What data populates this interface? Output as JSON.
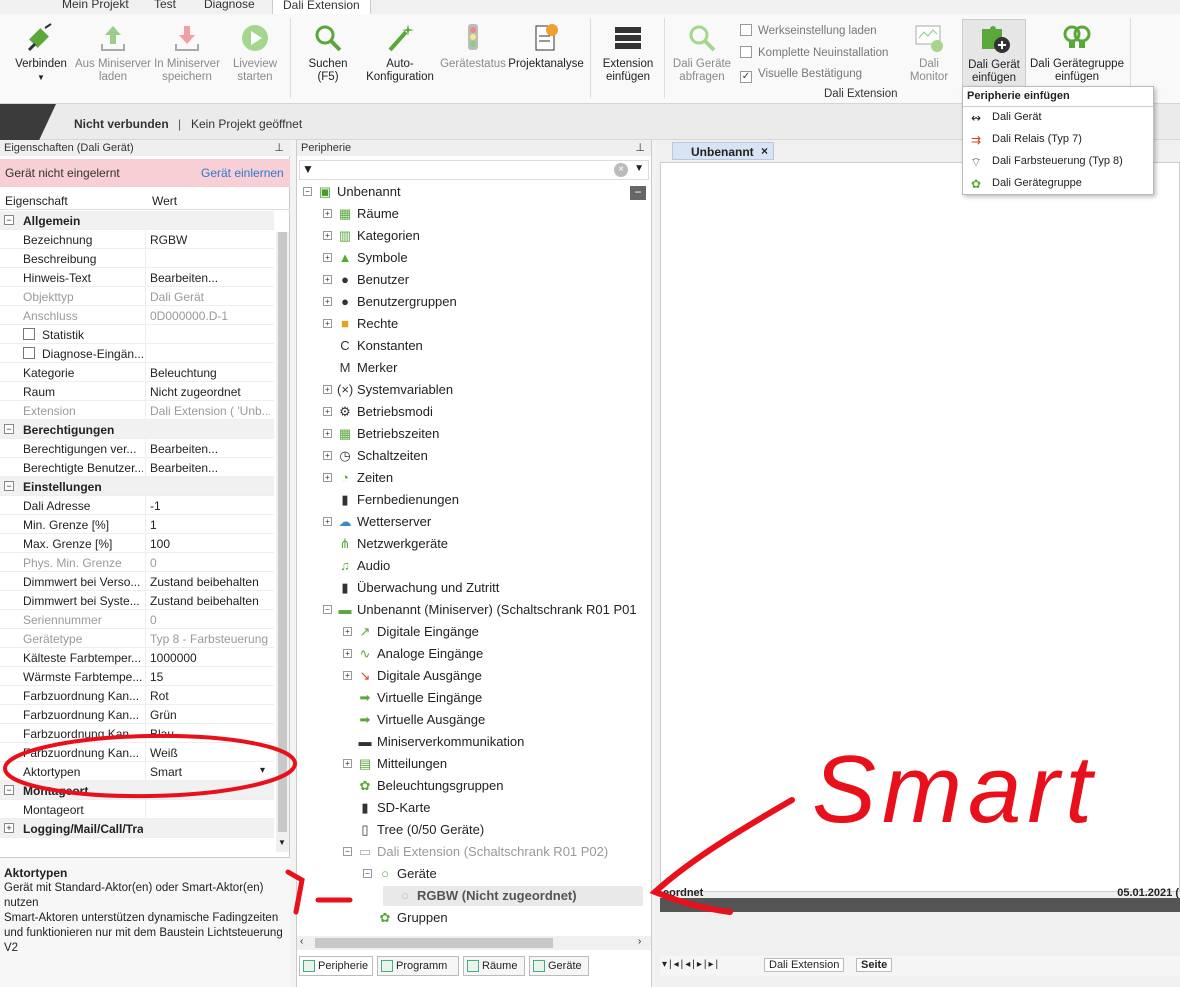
{
  "ribbon": {
    "tabs": [
      "Mein Projekt",
      "Test",
      "Diagnose",
      "Dali Extension"
    ],
    "buttons": {
      "verbinden": "Verbinden",
      "aus_miniserver": "Aus Miniserver\nladen",
      "in_miniserver": "In Miniserver\nspeichern",
      "liveview": "Liveview\nstarten",
      "suchen": "Suchen\n(F5)",
      "autokonfig": "Auto-\nKonfiguration",
      "geraetestatus": "Gerätestatus",
      "projektanalyse": "Projektanalyse",
      "extension_einfuegen": "Extension\neinfügen",
      "dali_abfragen": "Dali Geräte\nabfragen",
      "dali_monitor": "Dali\nMonitor",
      "dali_geraet_einfuegen": "Dali Gerät\neinfügen",
      "dali_gruppe_einfuegen": "Dali Gerätegruppe\neinfügen"
    },
    "checkboxes": [
      "Werkseinstellung laden",
      "Komplette Neuinstallation",
      "Visuelle Bestätigung"
    ],
    "checkbox_checked": [
      false,
      false,
      true
    ],
    "group_label": "Dali Extension"
  },
  "dropdown": {
    "title": "Peripherie einfügen",
    "items": [
      "Dali Gerät",
      "Dali Relais (Typ 7)",
      "Dali Farbsteuerung (Typ 8)",
      "Dali Gerätegruppe"
    ]
  },
  "status": {
    "connection": "Nicht verbunden",
    "separator": "|",
    "project": "Kein Projekt geöffnet"
  },
  "properties": {
    "header": "Eigenschaften (Dali Gerät)",
    "warning": "Gerät nicht eingelernt",
    "warning_link": "Gerät einlernen",
    "col_key": "Eigenschaft",
    "col_value": "Wert",
    "rows": [
      {
        "k": "Allgemein",
        "v": "",
        "cat": true,
        "pm": "−"
      },
      {
        "k": "Bezeichnung",
        "v": "RGBW"
      },
      {
        "k": "Beschreibung",
        "v": ""
      },
      {
        "k": "Hinweis-Text",
        "v": "Bearbeiten..."
      },
      {
        "k": "Objekttyp",
        "v": "Dali Gerät",
        "dim": true
      },
      {
        "k": "Anschluss",
        "v": "0D000000.D-1",
        "dim": true
      },
      {
        "k": "Statistik",
        "v": "",
        "cb": true
      },
      {
        "k": "Diagnose-Eingän...",
        "v": "",
        "cb": true
      },
      {
        "k": "Kategorie",
        "v": "Beleuchtung"
      },
      {
        "k": "Raum",
        "v": "Nicht zugeordnet"
      },
      {
        "k": "Extension",
        "v": "Dali Extension ( 'Unb...",
        "dim": true
      },
      {
        "k": "Berechtigungen",
        "v": "",
        "cat": true,
        "pm": "−"
      },
      {
        "k": "Berechtigungen ver...",
        "v": "Bearbeiten..."
      },
      {
        "k": "Berechtigte Benutzer...",
        "v": "Bearbeiten..."
      },
      {
        "k": "Einstellungen",
        "v": "",
        "cat": true,
        "pm": "−"
      },
      {
        "k": "Dali Adresse",
        "v": "-1"
      },
      {
        "k": "Min. Grenze [%]",
        "v": "1"
      },
      {
        "k": "Max. Grenze [%]",
        "v": "100"
      },
      {
        "k": "Phys. Min. Grenze",
        "v": "0",
        "dim": true
      },
      {
        "k": "Dimmwert bei Verso...",
        "v": "Zustand beibehalten"
      },
      {
        "k": "Dimmwert bei Syste...",
        "v": "Zustand beibehalten"
      },
      {
        "k": "Seriennummer",
        "v": "0",
        "dim": true
      },
      {
        "k": "Gerätetype",
        "v": "Typ 8 - Farbsteuerung",
        "dim": true
      },
      {
        "k": "Kälteste Farbtemper...",
        "v": "1000000"
      },
      {
        "k": "Wärmste Farbtempe...",
        "v": "15"
      },
      {
        "k": "Farbzuordnung Kan...",
        "v": "Rot"
      },
      {
        "k": "Farbzuordnung Kan...",
        "v": "Grün"
      },
      {
        "k": "Farbzuordnung Kan...",
        "v": "Blau"
      },
      {
        "k": "Farbzuordnung Kan...",
        "v": "Weiß"
      },
      {
        "k": "Aktortypen",
        "v": "Smart",
        "dd": true
      },
      {
        "k": "Montageort",
        "v": "",
        "cat": true,
        "pm": "−"
      },
      {
        "k": "Montageort",
        "v": ""
      },
      {
        "k": "Logging/Mail/Call/Track",
        "v": "",
        "cat": true,
        "pm": "+"
      }
    ],
    "desc_title": "Aktortypen",
    "desc_text": "Gerät mit Standard-Aktor(en) oder Smart-Aktor(en) nutzen\nSmart-Aktoren unterstützen dynamische Fadingzeiten und funktionieren nur mit dem Baustein Lichtsteuerung V2"
  },
  "tree": {
    "header": "Peripherie",
    "nodes": [
      {
        "label": "Unbenannt",
        "indent": 0,
        "exp": "−",
        "icon": "▣",
        "color": "#4a9a2a"
      },
      {
        "label": "Räume",
        "indent": 1,
        "exp": "+",
        "icon": "▦",
        "color": "#5aa83a"
      },
      {
        "label": "Kategorien",
        "indent": 1,
        "exp": "+",
        "icon": "▥",
        "color": "#5aa83a"
      },
      {
        "label": "Symbole",
        "indent": 1,
        "exp": "+",
        "icon": "▲",
        "color": "#5aa83a"
      },
      {
        "label": "Benutzer",
        "indent": 1,
        "exp": "+",
        "icon": "●",
        "color": "#333"
      },
      {
        "label": "Benutzergruppen",
        "indent": 1,
        "exp": "+",
        "icon": "●",
        "color": "#333"
      },
      {
        "label": "Rechte",
        "indent": 1,
        "exp": "+",
        "icon": "■",
        "color": "#e8a020"
      },
      {
        "label": "Konstanten",
        "indent": 1,
        "exp": "",
        "icon": "C",
        "color": "#333"
      },
      {
        "label": "Merker",
        "indent": 1,
        "exp": "",
        "icon": "M",
        "color": "#333"
      },
      {
        "label": "Systemvariablen",
        "indent": 1,
        "exp": "+",
        "icon": "(×)",
        "color": "#333"
      },
      {
        "label": "Betriebsmodi",
        "indent": 1,
        "exp": "+",
        "icon": "⚙",
        "color": "#333"
      },
      {
        "label": "Betriebszeiten",
        "indent": 1,
        "exp": "+",
        "icon": "▦",
        "color": "#5aa83a"
      },
      {
        "label": "Schaltzeiten",
        "indent": 1,
        "exp": "+",
        "icon": "◷",
        "color": "#333"
      },
      {
        "label": "Zeiten",
        "indent": 1,
        "exp": "+",
        "icon": "◔",
        "color": "#5aa83a"
      },
      {
        "label": "Fernbedienungen",
        "indent": 1,
        "exp": "",
        "icon": "▮",
        "color": "#333"
      },
      {
        "label": "Wetterserver",
        "indent": 1,
        "exp": "+",
        "icon": "☁",
        "color": "#3a8ad0"
      },
      {
        "label": "Netzwerkgeräte",
        "indent": 1,
        "exp": "",
        "icon": "⋔",
        "color": "#5aa83a"
      },
      {
        "label": "Audio",
        "indent": 1,
        "exp": "",
        "icon": "♫",
        "color": "#5aa83a"
      },
      {
        "label": "Überwachung und Zutritt",
        "indent": 1,
        "exp": "",
        "icon": "▮",
        "color": "#333"
      },
      {
        "label": "Unbenannt (Miniserver) (Schaltschrank R01 P01",
        "indent": 1,
        "exp": "−",
        "icon": "▬",
        "color": "#5aa83a"
      },
      {
        "label": "Digitale Eingänge",
        "indent": 2,
        "exp": "+",
        "icon": "↗",
        "color": "#5aa83a"
      },
      {
        "label": "Analoge Eingänge",
        "indent": 2,
        "exp": "+",
        "icon": "∿",
        "color": "#5aa83a"
      },
      {
        "label": "Digitale Ausgänge",
        "indent": 2,
        "exp": "+",
        "icon": "↘",
        "color": "#d04020"
      },
      {
        "label": "Virtuelle Eingänge",
        "indent": 2,
        "exp": "",
        "icon": "➡",
        "color": "#5aa83a"
      },
      {
        "label": "Virtuelle Ausgänge",
        "indent": 2,
        "exp": "",
        "icon": "➡",
        "color": "#5aa83a"
      },
      {
        "label": "Miniserverkommunikation",
        "indent": 2,
        "exp": "",
        "icon": "▬",
        "color": "#333"
      },
      {
        "label": "Mitteilungen",
        "indent": 2,
        "exp": "+",
        "icon": "▤",
        "color": "#5aa83a"
      },
      {
        "label": "Beleuchtungsgruppen",
        "indent": 2,
        "exp": "",
        "icon": "✿",
        "color": "#5aa83a"
      },
      {
        "label": "SD-Karte",
        "indent": 2,
        "exp": "",
        "icon": "▮",
        "color": "#333"
      },
      {
        "label": "Tree  (0/50 Geräte)",
        "indent": 2,
        "exp": "",
        "icon": "▯",
        "color": "#333"
      },
      {
        "label": "Dali Extension (Schaltschrank R01 P02)",
        "indent": 2,
        "exp": "−",
        "icon": "▭",
        "color": "#aaa",
        "dim": true
      },
      {
        "label": "Geräte",
        "indent": 3,
        "exp": "−",
        "icon": "○",
        "color": "#5aa83a"
      },
      {
        "label": "RGBW (Nicht zugeordnet)",
        "indent": 4,
        "exp": "",
        "icon": "○",
        "color": "#bbb",
        "sel": true
      },
      {
        "label": "Gruppen",
        "indent": 3,
        "exp": "",
        "icon": "✿",
        "color": "#5aa83a"
      }
    ],
    "bottom_tabs": [
      "Peripherie",
      "Programm",
      "Räume",
      "Geräte"
    ]
  },
  "document": {
    "tab": "Unbenannt",
    "footer_left": "eordnet",
    "footer_right": "05.01.2021 (",
    "page_tabs": [
      "Dali Extension",
      "Seite"
    ]
  },
  "annotation": {
    "text": "Smart",
    "color": "#e8101a"
  }
}
